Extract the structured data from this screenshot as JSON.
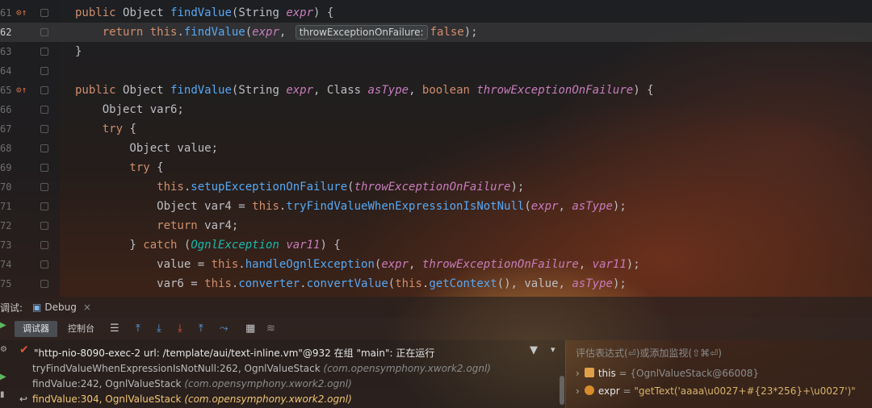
{
  "code_lines": [
    {
      "num": "61",
      "cur": false,
      "marker": true,
      "tokens": [
        [
          "kw",
          "public "
        ],
        [
          "cls",
          "Object "
        ],
        [
          "fn",
          "findValue"
        ],
        [
          "cls",
          "(String "
        ],
        [
          "prm",
          "expr"
        ],
        [
          "cls",
          ") {"
        ]
      ]
    },
    {
      "num": "62",
      "cur": true,
      "marker": false,
      "tokens": [
        [
          "kw",
          "    return "
        ],
        [
          "kw",
          "this"
        ],
        [
          "cls",
          "."
        ],
        [
          "fn",
          "findValue"
        ],
        [
          "cls",
          "("
        ],
        [
          "prm",
          "expr"
        ],
        [
          "cls",
          ", "
        ],
        [
          "hint",
          "throwExceptionOnFailure:"
        ],
        [
          "kw",
          "false"
        ],
        [
          "cls",
          ");"
        ]
      ]
    },
    {
      "num": "63",
      "cur": false,
      "marker": false,
      "tokens": [
        [
          "cls",
          "}"
        ]
      ]
    },
    {
      "num": "64",
      "cur": false,
      "marker": false,
      "tokens": []
    },
    {
      "num": "65",
      "cur": false,
      "marker": true,
      "tokens": [
        [
          "kw",
          "public "
        ],
        [
          "cls",
          "Object "
        ],
        [
          "fn",
          "findValue"
        ],
        [
          "cls",
          "(String "
        ],
        [
          "prm",
          "expr"
        ],
        [
          "cls",
          ", Class "
        ],
        [
          "prm",
          "asType"
        ],
        [
          "cls",
          ", "
        ],
        [
          "kw",
          "boolean "
        ],
        [
          "prm",
          "throwExceptionOnFailure"
        ],
        [
          "cls",
          ") {"
        ]
      ]
    },
    {
      "num": "66",
      "cur": false,
      "marker": false,
      "tokens": [
        [
          "cls",
          "    Object var6;"
        ]
      ]
    },
    {
      "num": "67",
      "cur": false,
      "marker": false,
      "tokens": [
        [
          "kw",
          "    try "
        ],
        [
          "cls",
          "{"
        ]
      ]
    },
    {
      "num": "68",
      "cur": false,
      "marker": false,
      "tokens": [
        [
          "cls",
          "        Object value;"
        ]
      ]
    },
    {
      "num": "69",
      "cur": false,
      "marker": false,
      "tokens": [
        [
          "kw",
          "        try "
        ],
        [
          "cls",
          "{"
        ]
      ]
    },
    {
      "num": "70",
      "cur": false,
      "marker": false,
      "tokens": [
        [
          "kw",
          "            this"
        ],
        [
          "cls",
          "."
        ],
        [
          "fn",
          "setupExceptionOnFailure"
        ],
        [
          "cls",
          "("
        ],
        [
          "prm",
          "throwExceptionOnFailure"
        ],
        [
          "cls",
          ");"
        ]
      ]
    },
    {
      "num": "71",
      "cur": false,
      "marker": false,
      "tokens": [
        [
          "cls",
          "            Object var4 = "
        ],
        [
          "kw",
          "this"
        ],
        [
          "cls",
          "."
        ],
        [
          "fn",
          "tryFindValueWhenExpressionIsNotNull"
        ],
        [
          "cls",
          "("
        ],
        [
          "prm",
          "expr"
        ],
        [
          "cls",
          ", "
        ],
        [
          "prm",
          "asType"
        ],
        [
          "cls",
          ");"
        ]
      ]
    },
    {
      "num": "72",
      "cur": false,
      "marker": false,
      "tokens": [
        [
          "kw",
          "            return "
        ],
        [
          "cls",
          "var4;"
        ]
      ]
    },
    {
      "num": "73",
      "cur": false,
      "marker": false,
      "tokens": [
        [
          "cls",
          "        } "
        ],
        [
          "kw",
          "catch "
        ],
        [
          "cls",
          "("
        ],
        [
          "itype",
          "OgnlException "
        ],
        [
          "prm",
          "var11"
        ],
        [
          "cls",
          ") {"
        ]
      ]
    },
    {
      "num": "74",
      "cur": false,
      "marker": false,
      "tokens": [
        [
          "cls",
          "            value = "
        ],
        [
          "kw",
          "this"
        ],
        [
          "cls",
          "."
        ],
        [
          "fn",
          "handleOgnlException"
        ],
        [
          "cls",
          "("
        ],
        [
          "prm",
          "expr"
        ],
        [
          "cls",
          ", "
        ],
        [
          "prm",
          "throwExceptionOnFailure"
        ],
        [
          "cls",
          ", "
        ],
        [
          "prm",
          "var11"
        ],
        [
          "cls",
          ");"
        ]
      ]
    },
    {
      "num": "75",
      "cur": false,
      "marker": false,
      "tokens": [
        [
          "cls",
          "            var6 = "
        ],
        [
          "kw",
          "this"
        ],
        [
          "cls",
          "."
        ],
        [
          "fn",
          "converter"
        ],
        [
          "cls",
          "."
        ],
        [
          "fn",
          "convertValue"
        ],
        [
          "cls",
          "("
        ],
        [
          "kw",
          "this"
        ],
        [
          "cls",
          "."
        ],
        [
          "fn",
          "getContext"
        ],
        [
          "cls",
          "(), value, "
        ],
        [
          "prm",
          "asType"
        ],
        [
          "cls",
          ");"
        ]
      ]
    }
  ],
  "tool_window": {
    "label": "调试:",
    "tab": "Debug"
  },
  "toolbar": {
    "tab_debugger": "调试器",
    "tab_console": "控制台"
  },
  "thread": {
    "text": "\"http-nio-8090-exec-2 url: /template/aui/text-inline.vm\"@932 在组 \"main\": 正在运行"
  },
  "frames": [
    {
      "method": "tryFindValueWhenExpressionIsNotNull:262, OgnlValueStack",
      "pkg": "(com.opensymphony.xwork2.ognl)",
      "selected": false
    },
    {
      "method": "findValue:242, OgnlValueStack",
      "pkg": "(com.opensymphony.xwork2.ognl)",
      "selected": false
    },
    {
      "method": "findValue:304, OgnlValueStack",
      "pkg": "(com.opensymphony.xwork2.ognl)",
      "selected": true
    }
  ],
  "variables": {
    "eval_placeholder": "评估表达式(⏎)或添加监视(⇧⌘⏎)",
    "items": [
      {
        "name": "this",
        "value": "{OgnlValueStack@66008}",
        "string": false
      },
      {
        "name": "expr",
        "value": "\"getText('aaaa\\u0027+#{23*256}+\\u0027')\"",
        "string": true
      }
    ]
  },
  "colors": {
    "keyword": "#cf8e6d",
    "function": "#56a8f5",
    "param": "#c77dbb"
  }
}
